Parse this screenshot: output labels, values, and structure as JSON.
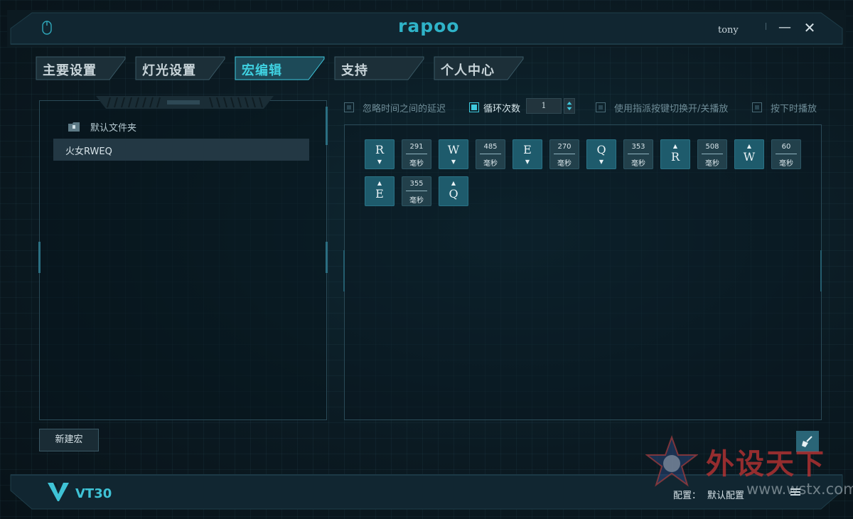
{
  "header": {
    "logo": "rapoo",
    "username": "tony",
    "minimize_symbol": "—",
    "close_symbol": "✕"
  },
  "tabs": [
    {
      "label": "主要设置",
      "active": false
    },
    {
      "label": "灯光设置",
      "active": false
    },
    {
      "label": "宏编辑",
      "active": true
    },
    {
      "label": "支持",
      "active": false
    },
    {
      "label": "个人中心",
      "active": false
    }
  ],
  "macro_list": {
    "folder_label": "默认文件夹",
    "items": [
      "火女RWEQ"
    ],
    "new_button": "新建宏"
  },
  "options": {
    "ignore_delay": {
      "label": "忽略时间之间的延迟",
      "checked": false
    },
    "loop_count": {
      "label": "循环次数",
      "checked": true,
      "value": "1"
    },
    "toggle_with_key": {
      "label": "使用指派按键切换开/关播放",
      "checked": false
    },
    "play_while_held": {
      "label": "按下时播放",
      "checked": false
    }
  },
  "delay_unit": "毫秒",
  "sequence": [
    {
      "type": "key",
      "key": "R",
      "dir": "down",
      "arrow": "▼"
    },
    {
      "type": "delay",
      "ms": "291"
    },
    {
      "type": "key",
      "key": "W",
      "dir": "down",
      "arrow": "▼"
    },
    {
      "type": "delay",
      "ms": "485"
    },
    {
      "type": "key",
      "key": "E",
      "dir": "down",
      "arrow": "▼"
    },
    {
      "type": "delay",
      "ms": "270"
    },
    {
      "type": "key",
      "key": "Q",
      "dir": "down",
      "arrow": "▼"
    },
    {
      "type": "delay",
      "ms": "353"
    },
    {
      "type": "key",
      "key": "R",
      "dir": "up",
      "arrow": "▲"
    },
    {
      "type": "delay",
      "ms": "508"
    },
    {
      "type": "key",
      "key": "W",
      "dir": "up",
      "arrow": "▲"
    },
    {
      "type": "delay",
      "ms": "60"
    },
    {
      "type": "key",
      "key": "E",
      "dir": "up",
      "arrow": "▲"
    },
    {
      "type": "delay",
      "ms": "355"
    },
    {
      "type": "key",
      "key": "Q",
      "dir": "up",
      "arrow": "▲"
    }
  ],
  "footer": {
    "model": "VT30",
    "config_label": "配置：",
    "config_value": "默认配置"
  },
  "watermark": {
    "title": "外设天下",
    "url": "www.wstx.com"
  },
  "colors": {
    "accent": "#3fc9de",
    "key_bg": "#1e5b6c",
    "delay_bg": "#22404b",
    "watermark_red": "#c43434"
  }
}
